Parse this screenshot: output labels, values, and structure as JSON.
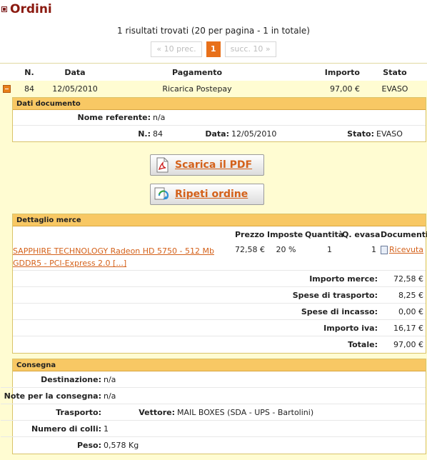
{
  "page": {
    "title": "Ordini",
    "results_text": "1 risultati trovati (20 per pagina - 1 in totale)"
  },
  "pager": {
    "prev_label": "« 10 prec.",
    "current_page": "1",
    "next_label": "succ. 10 »"
  },
  "orders": {
    "headers": {
      "n": "N.",
      "data": "Data",
      "pagamento": "Pagamento",
      "importo": "Importo",
      "stato": "Stato"
    },
    "rows": [
      {
        "n": "84",
        "data": "12/05/2010",
        "pagamento": "Ricarica Postepay",
        "importo": "97,00 €",
        "stato": "EVASO"
      }
    ]
  },
  "dati_documento": {
    "title": "Dati documento",
    "nome_referente_label": "Nome referente:",
    "nome_referente_value": "n/a",
    "n_label": "N.:",
    "n_value": "84",
    "data_label": "Data:",
    "data_value": "12/05/2010",
    "stato_label": "Stato:",
    "stato_value": "EVASO"
  },
  "buttons": {
    "pdf_label": "Scarica il PDF",
    "repeat_label": "Ripeti ordine"
  },
  "dettaglio_merce": {
    "title": "Dettaglio merce",
    "headers": {
      "prezzo": "Prezzo",
      "imposte": "Imposte",
      "quantita": "Quantità",
      "q_evasa": "Q. evasa",
      "documenti": "Documenti"
    },
    "items": [
      {
        "name": "SAPPHIRE TECHNOLOGY Radeon HD 5750 - 512 Mb GDDR5 - PCI-Express 2.0 [...]",
        "prezzo": "72,58 €",
        "imposte": "20 %",
        "quantita": "1",
        "q_evasa": "1",
        "documento": "Ricevuta"
      }
    ],
    "totals": [
      {
        "label": "Importo merce:",
        "value": "72,58 €"
      },
      {
        "label": "Spese di trasporto:",
        "value": "8,25 €"
      },
      {
        "label": "Spese di incasso:",
        "value": "0,00 €"
      },
      {
        "label": "Importo iva:",
        "value": "16,17 €"
      },
      {
        "label": "Totale:",
        "value": "97,00 €"
      }
    ]
  },
  "consegna": {
    "title": "Consegna",
    "destinazione_label": "Destinazione:",
    "destinazione_value": "n/a",
    "note_label": "Note per la consegna:",
    "note_value": "n/a",
    "trasporto_label": "Trasporto:",
    "vettore_label": "Vettore:",
    "vettore_value": "MAIL BOXES (SDA - UPS - Bartolini)",
    "colli_label": "Numero di colli:",
    "colli_value": "1",
    "peso_label": "Peso:",
    "peso_value": "0,578 Kg"
  },
  "colors": {
    "title": "#8b1a10",
    "accent": "#e8701a",
    "link": "#d4611a",
    "row_bg": "#fffcd2",
    "section_header": "#f8c864"
  },
  "icons": {
    "title_bullet": "square-bullet-icon",
    "collapse": "minus-icon",
    "pdf": "pdf-icon",
    "repeat": "repeat-icon",
    "document": "document-icon"
  }
}
